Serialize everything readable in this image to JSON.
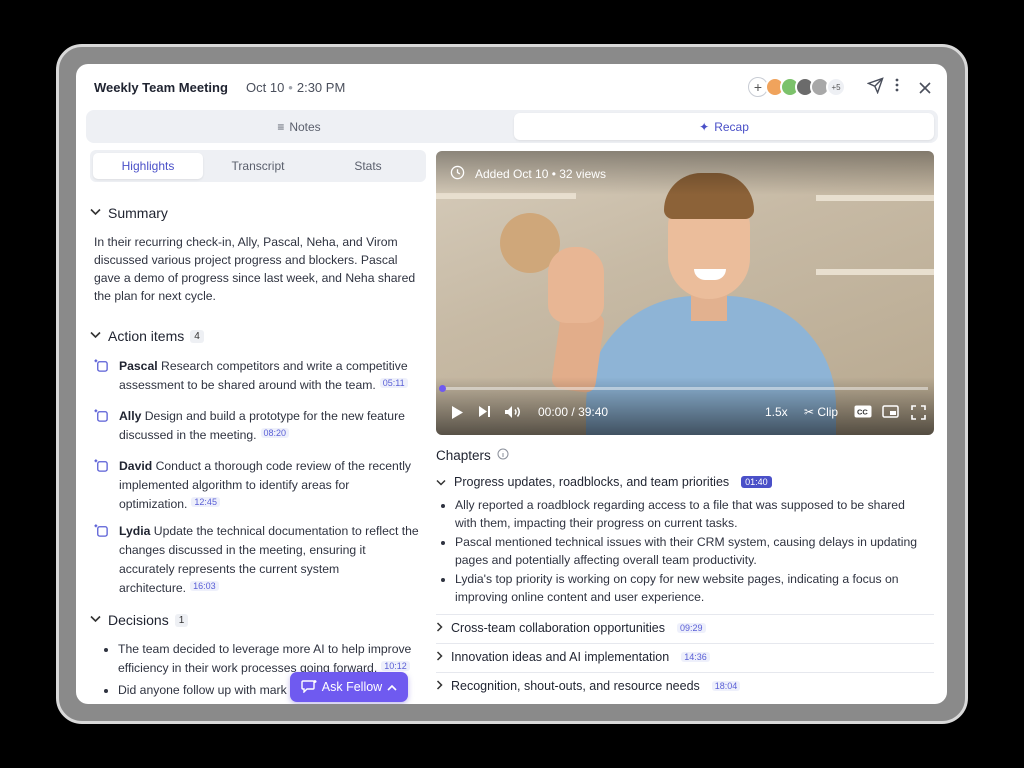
{
  "header": {
    "title": "Weekly Team Meeting",
    "date": "Oct 10",
    "time": "2:30 PM",
    "participants_more": "+5",
    "avatar_colors": [
      "#f0a35c",
      "#7cc26b",
      "#6b6b6b",
      "#a8a8a8"
    ]
  },
  "view_tabs": [
    {
      "label": "Notes",
      "icon": "notes-icon",
      "active": false
    },
    {
      "label": "Recap",
      "icon": "sparkle-icon",
      "active": true
    }
  ],
  "subtabs": [
    "Highlights",
    "Transcript",
    "Stats"
  ],
  "summary": {
    "heading": "Summary",
    "text": "In their recurring check-in, Ally, Pascal, Neha, and Virom discussed various project progress and blockers. Pascal gave a demo of progress since last week, and Neha shared the plan for next cycle."
  },
  "action_items": {
    "heading": "Action items",
    "count": "4",
    "items": [
      {
        "owner": "Pascal",
        "text": "Research competitors and write a competitive assessment to be shared around with the team.",
        "time": "05:11"
      },
      {
        "owner": "Ally",
        "text": "Design and build a prototype for the new feature discussed in the meeting.",
        "time": "08:20"
      },
      {
        "owner": "David",
        "text": "Conduct a thorough code review of the recently implemented algorithm to identify areas for optimization.",
        "time": "12:45"
      },
      {
        "owner": "Lydia",
        "text": "Update the technical documentation to reflect the changes discussed in the meeting, ensuring it accurately represents the current system architecture.",
        "time": "16:03"
      }
    ]
  },
  "decisions": {
    "heading": "Decisions",
    "count": "1",
    "items": [
      {
        "text": "The team decided to leverage more AI to help improve efficiency in their work processes going forward.",
        "time": "10:12"
      },
      {
        "text": "Did anyone follow up with mark",
        "time": ""
      }
    ]
  },
  "ask_button": "Ask Fellow",
  "video": {
    "info": "Added Oct 10 • 32 views",
    "current_time": "00:00",
    "duration": "39:40",
    "separator": "/",
    "speed": "1.5x",
    "clip": "Clip",
    "progress_fraction": 0.0
  },
  "chapters": {
    "heading": "Chapters",
    "items": [
      {
        "title": "Progress updates, roadblocks, and team priorities",
        "time": "01:40",
        "expanded": true,
        "bullets": [
          "Ally reported a roadblock regarding access to a file that was supposed to be shared with them, impacting their progress on current tasks.",
          "Pascal mentioned technical issues with their CRM system, causing delays in updating pages and potentially affecting overall team productivity.",
          "Lydia's top priority is working on copy for new website pages, indicating a focus on improving online content and user experience."
        ]
      },
      {
        "title": "Cross-team collaboration opportunities",
        "time": "09:29",
        "expanded": false
      },
      {
        "title": "Innovation ideas and AI implementation",
        "time": "14:36",
        "expanded": false
      },
      {
        "title": "Recognition, shout-outs, and resource needs",
        "time": "18:04",
        "expanded": false
      }
    ]
  },
  "colors": {
    "accent": "#6f5af0",
    "accent_text": "#4a50c8",
    "tab_bg": "#eef0f4"
  }
}
